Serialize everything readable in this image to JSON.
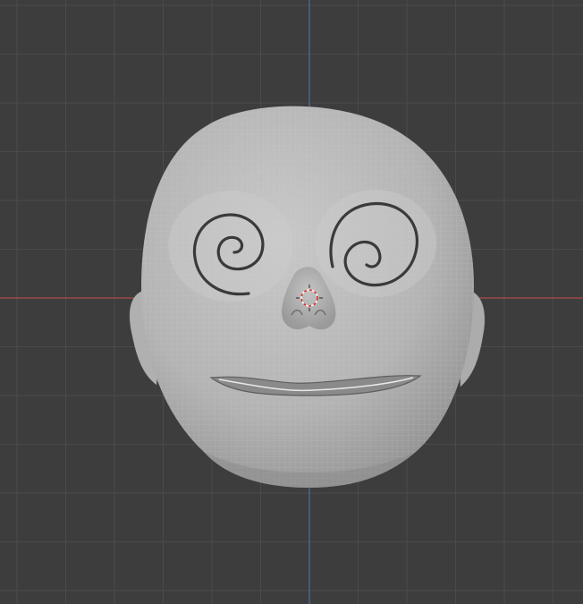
{
  "viewport": {
    "background_color": "#3d3d3d",
    "grid_minor_color": "#444444",
    "grid_major_color": "#4a4a4a",
    "x_axis_color": "#c64a55",
    "y_axis_color": "#4f79b5"
  },
  "scene": {
    "object_shape": "sculpted-head",
    "object_color": "#bdbdbd",
    "object_shadow_color": "#7a7a7a",
    "wire_color": "#d9d9d9",
    "eye_style": "spiral",
    "cursor_icon": "3d-cursor-icon",
    "cursor_colors": [
      "#e0302a",
      "#f4f4f4"
    ]
  }
}
